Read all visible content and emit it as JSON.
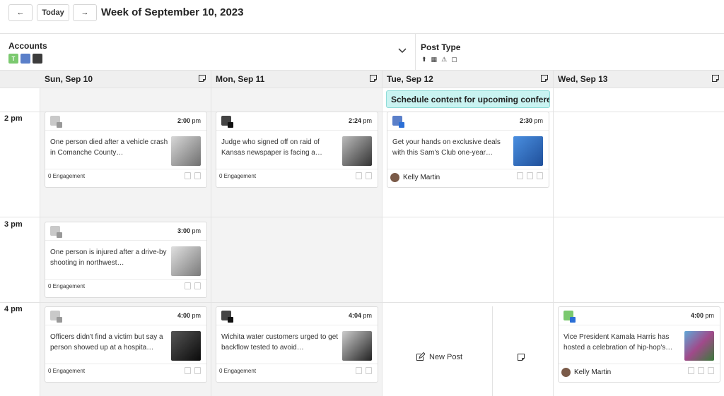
{
  "header": {
    "back_label": "←",
    "today_label": "Today",
    "forward_label": "→",
    "week_title": "Week of September 10, 2023"
  },
  "filters": {
    "accounts_label": "Accounts",
    "post_type_label": "Post Type",
    "post_type_icons": [
      "upload-icon",
      "calendar-icon",
      "alert-icon",
      "note-icon"
    ]
  },
  "days": [
    {
      "label": "Sun, Sep 10"
    },
    {
      "label": "Mon, Sep 11"
    },
    {
      "label": "Tue, Sep 12"
    },
    {
      "label": "Wed, Sep 13"
    }
  ],
  "times": [
    "2 pm",
    "3 pm",
    "4 pm"
  ],
  "banner": {
    "text": "Schedule content for upcoming conference"
  },
  "cards": [
    {
      "time": "2:00",
      "ampm": "pm",
      "text": "One person died after a vehicle crash in Comanche County…",
      "footer": "0 Engagement"
    },
    {
      "time": "2:24",
      "ampm": "pm",
      "text": "Judge who signed off on raid of Kansas newspaper is facing a…",
      "footer": "0 Engagement"
    },
    {
      "time": "2:30",
      "ampm": "pm",
      "text": "Get your hands on exclusive deals with this Sam's Club one-year…",
      "author": "Kelly Martin"
    },
    {
      "time": "3:00",
      "ampm": "pm",
      "text": "One person is injured after a drive-by shooting in northwest…",
      "footer": "0 Engagement"
    },
    {
      "time": "4:00",
      "ampm": "pm",
      "text": "Officers didn't find a victim but say a person showed up at a hospita…",
      "footer": "0 Engagement"
    },
    {
      "time": "4:04",
      "ampm": "pm",
      "text": "Wichita water customers urged to get backflow tested to avoid…",
      "footer": "0 Engagement"
    },
    {
      "time": "4:00",
      "ampm": "pm",
      "text": "Vice President Kamala Harris has hosted a celebration of hip-hop's…",
      "author": "Kelly Martin"
    }
  ],
  "new_post_label": "New Post",
  "colors": {
    "banner_bg": "#c9f3f1",
    "grid_shade": "#f3f3f3",
    "header_bg": "#efefef"
  }
}
